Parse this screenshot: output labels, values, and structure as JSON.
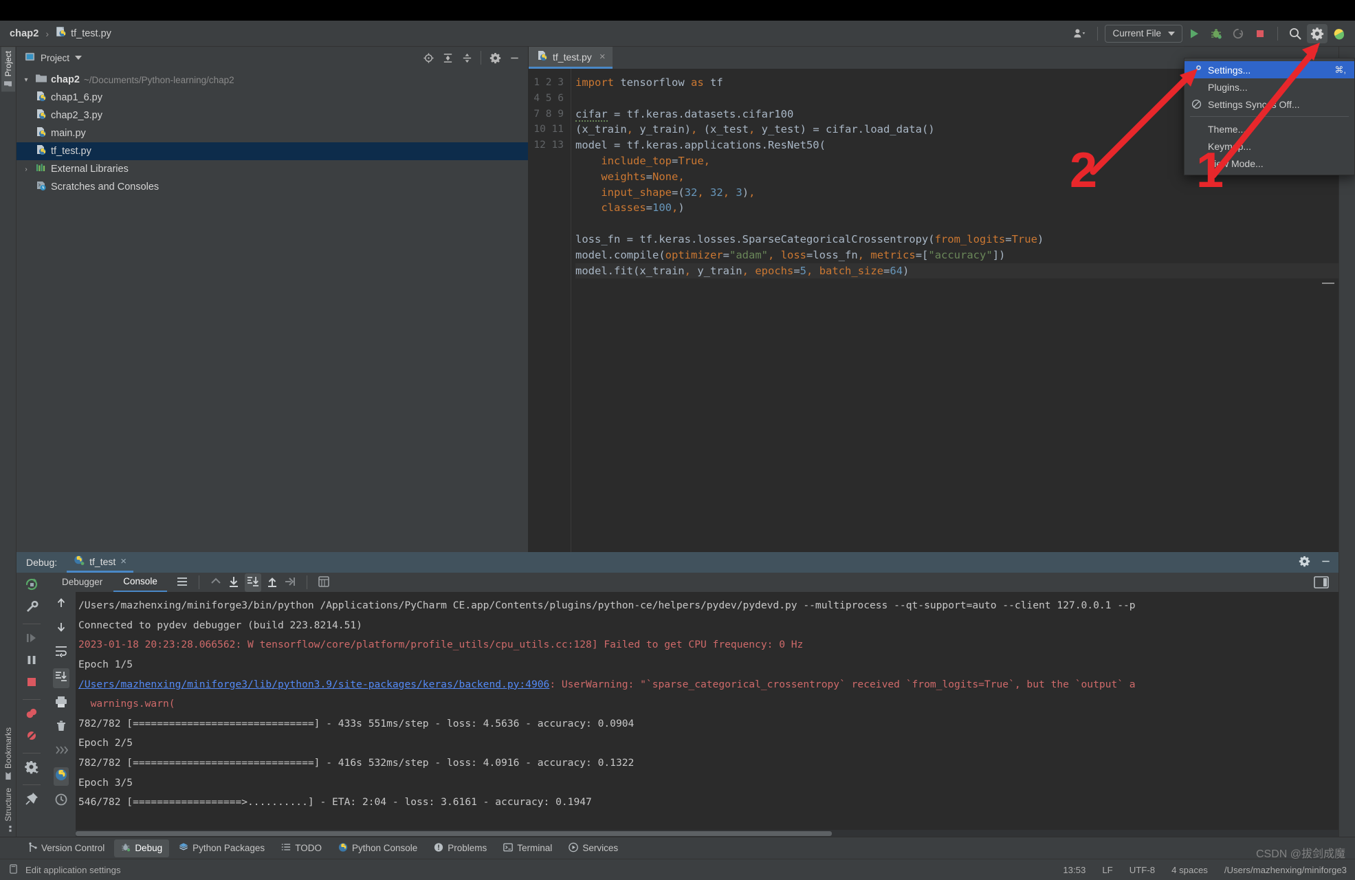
{
  "window": {
    "breadcrumb": {
      "project": "chap2",
      "separator": "›",
      "file": "tf_test.py"
    }
  },
  "toolbar": {
    "run_config": "Current File",
    "icons": [
      "user-avatar-icon",
      "run-icon",
      "debug-icon",
      "attach-process-icon",
      "stop-icon",
      "search-everywhere-icon",
      "settings-gear-icon",
      "updates-icon"
    ]
  },
  "left_strip": {
    "tabs": [
      "Project",
      "Bookmarks",
      "Structure"
    ]
  },
  "project_panel": {
    "title": "Project",
    "header_icons": [
      "locate-icon",
      "expand-all-icon",
      "collapse-all-icon",
      "gear-icon",
      "hide-icon"
    ],
    "tree": [
      {
        "label": "chap2",
        "path": "~/Documents/Python-learning/chap2",
        "icon": "folder-icon",
        "expanded": true,
        "depth": 0,
        "selected": false
      },
      {
        "label": "chap1_6.py",
        "path": "",
        "icon": "python-file-icon",
        "depth": 1,
        "selected": false
      },
      {
        "label": "chap2_3.py",
        "path": "",
        "icon": "python-file-icon",
        "depth": 1,
        "selected": false
      },
      {
        "label": "main.py",
        "path": "",
        "icon": "python-file-icon",
        "depth": 1,
        "selected": false
      },
      {
        "label": "tf_test.py",
        "path": "",
        "icon": "python-file-icon",
        "depth": 1,
        "selected": true
      },
      {
        "label": "External Libraries",
        "path": "",
        "icon": "library-icon",
        "expanded": false,
        "depth": 0,
        "selected": false
      },
      {
        "label": "Scratches and Consoles",
        "path": "",
        "icon": "scratches-icon",
        "depth": 0,
        "selected": false
      }
    ]
  },
  "editor": {
    "tab": {
      "label": "tf_test.py",
      "icon": "python-file-icon",
      "close": "×"
    },
    "line_numbers": [
      "1",
      "2",
      "3",
      "4",
      "5",
      "6",
      "7",
      "8",
      "9",
      "10",
      "11",
      "12",
      "13"
    ],
    "code_lines": [
      "import tensorflow as tf",
      "",
      "cifar = tf.keras.datasets.cifar100",
      "(x_train, y_train), (x_test, y_test) = cifar.load_data()",
      "model = tf.keras.applications.ResNet50(",
      "    include_top=True,",
      "    weights=None,",
      "    input_shape=(32, 32, 3),",
      "    classes=100,)",
      "",
      "loss_fn = tf.keras.losses.SparseCategoricalCrossentropy(from_logits=True)",
      "model.compile(optimizer=\"adam\", loss=loss_fn, metrics=[\"accuracy\"])",
      "model.fit(x_train, y_train, epochs=5, batch_size=64)"
    ]
  },
  "settings_menu": {
    "items": [
      {
        "label": "Settings...",
        "icon": "wrench-icon",
        "shortcut": "⌘,",
        "highlighted": true
      },
      {
        "label": "Plugins...",
        "icon": "",
        "shortcut": "",
        "highlighted": false
      },
      {
        "label": "Settings Sync is Off...",
        "icon": "sync-off-icon",
        "shortcut": "",
        "highlighted": false
      },
      {
        "label": "Theme...",
        "icon": "",
        "shortcut": "",
        "highlighted": false
      },
      {
        "label": "Keymap...",
        "icon": "",
        "shortcut": "",
        "highlighted": false
      },
      {
        "label": "View Mode...",
        "icon": "",
        "shortcut": "",
        "highlighted": false
      }
    ]
  },
  "annotations": {
    "marker_one": "1",
    "marker_two": "2"
  },
  "debug_panel": {
    "title": "Debug:",
    "session_tab": "tf_test",
    "session_close": "×",
    "tabs": [
      {
        "label": "Debugger",
        "selected": false
      },
      {
        "label": "Console",
        "selected": true
      }
    ],
    "left_tools": [
      "rerun-icon",
      "wrench-icon",
      "resume-icon",
      "pause-icon",
      "stop-icon",
      "view-breakpoints-icon",
      "mute-breakpoints-icon",
      "settings-icon",
      "pin-icon"
    ],
    "console_tools": [
      "up-icon",
      "down-icon",
      "soft-wrap-icon",
      "scroll-to-end-icon",
      "print-icon",
      "trash-icon",
      "forward-icon",
      "python-console-icon",
      "history-icon"
    ],
    "console_lines": [
      {
        "text": "/Users/mazhenxing/miniforge3/bin/python /Applications/PyCharm CE.app/Contents/plugins/python-ce/helpers/pydev/pydevd.py --multiprocess --qt-support=auto --client 127.0.0.1 --p",
        "style": "normal"
      },
      {
        "text": "Connected to pydev debugger (build 223.8214.51)",
        "style": "normal"
      },
      {
        "text": "2023-01-18 20:23:28.066562: W tensorflow/core/platform/profile_utils/cpu_utils.cc:128] Failed to get CPU frequency: 0 Hz",
        "style": "error"
      },
      {
        "text": "Epoch 1/5",
        "style": "normal"
      },
      {
        "text": "/Users/mazhenxing/miniforge3/lib/python3.9/site-packages/keras/backend.py:4906",
        "suffix": ": UserWarning: \"`sparse_categorical_crossentropy` received `from_logits=True`, but the `output` a",
        "style": "link-error"
      },
      {
        "text": "  warnings.warn(",
        "style": "error"
      },
      {
        "text": "782/782 [==============================] - 433s 551ms/step - loss: 4.5636 - accuracy: 0.0904",
        "style": "normal"
      },
      {
        "text": "Epoch 2/5",
        "style": "normal"
      },
      {
        "text": "782/782 [==============================] - 416s 532ms/step - loss: 4.0916 - accuracy: 0.1322",
        "style": "normal"
      },
      {
        "text": "Epoch 3/5",
        "style": "normal"
      },
      {
        "text": "546/782 [==================>..........] - ETA: 2:04 - loss: 3.6161 - accuracy: 0.1947",
        "style": "normal"
      }
    ]
  },
  "tool_window_bar": {
    "items": [
      {
        "label": "Version Control",
        "icon": "vcs-icon",
        "selected": false
      },
      {
        "label": "Debug",
        "icon": "debug-icon",
        "selected": true
      },
      {
        "label": "Python Packages",
        "icon": "packages-icon",
        "selected": false
      },
      {
        "label": "TODO",
        "icon": "todo-icon",
        "selected": false
      },
      {
        "label": "Python Console",
        "icon": "python-icon",
        "selected": false
      },
      {
        "label": "Problems",
        "icon": "problems-icon",
        "selected": false
      },
      {
        "label": "Terminal",
        "icon": "terminal-icon",
        "selected": false
      },
      {
        "label": "Services",
        "icon": "services-icon",
        "selected": false
      }
    ]
  },
  "status_bar": {
    "message": "Edit application settings",
    "message_icon": "tooltip-icon",
    "position": "13:53",
    "line_separator": "LF",
    "encoding": "UTF-8",
    "indent": "4 spaces",
    "interpreter": "/Users/mazhenxing/miniforge3",
    "watermark": "CSDN @拔剑成魔"
  },
  "colors": {
    "accent_blue": "#4a88c7",
    "menu_highlight": "#2f65ca",
    "annotation_red": "#e8272b",
    "selection_blue": "#0d2c4b",
    "editor_bg": "#2b2b2b",
    "chrome_bg": "#3c3f41"
  }
}
